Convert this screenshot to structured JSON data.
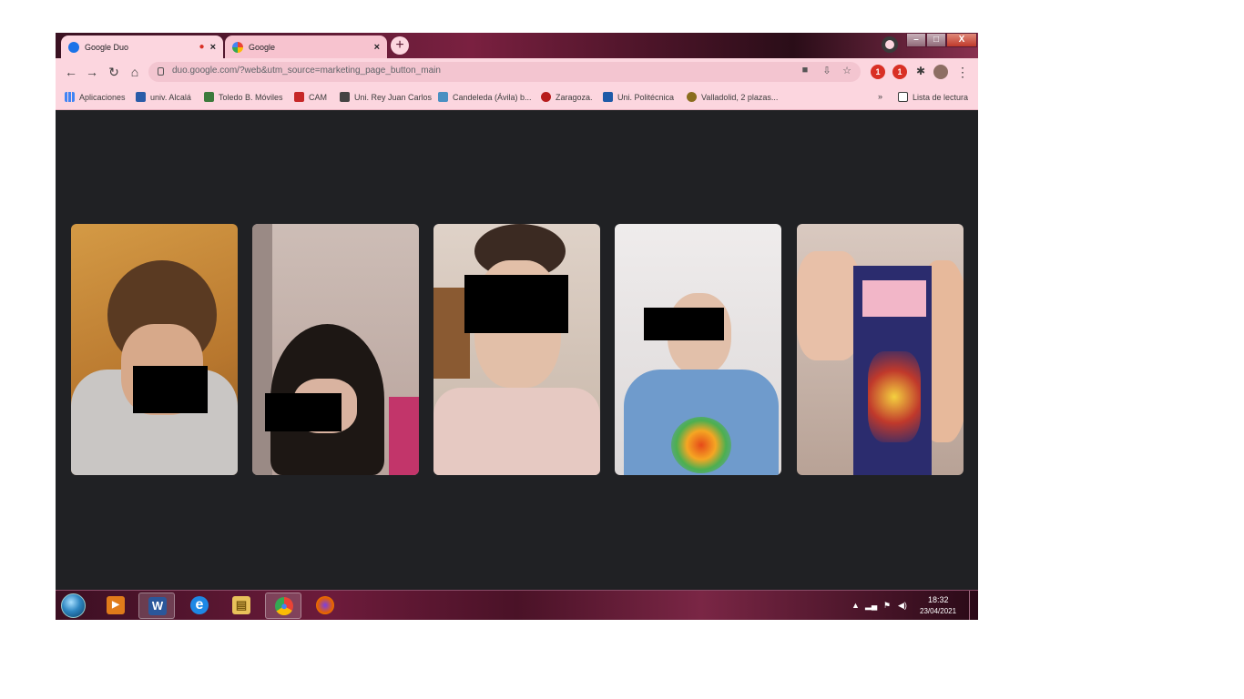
{
  "browser": {
    "tabs": [
      {
        "title": "Google Duo",
        "active": true
      },
      {
        "title": "Google",
        "active": false
      }
    ],
    "new_tab_label": "+",
    "address_bar": {
      "url": "duo.google.com/?web&utm_source=marketing_page_button_main"
    },
    "window_controls": {
      "minimize": "–",
      "maximize": "□",
      "close": "X"
    },
    "extensions": [
      {
        "name": "ext-1",
        "badge": "1",
        "color": "#d93025"
      },
      {
        "name": "ext-2",
        "badge": "1",
        "color": "#d93025"
      }
    ]
  },
  "bookmarks": {
    "items": [
      {
        "label": "Aplicaciones",
        "icon_color": "#4285f4"
      },
      {
        "label": "univ. Alcalá",
        "icon_color": "#2a5ca8"
      },
      {
        "label": "Toledo B. Móviles",
        "icon_color": "#3c7a3c"
      },
      {
        "label": "CAM",
        "icon_color": "#c62828"
      },
      {
        "label": "Uni. Rey Juan Carlos",
        "icon_color": "#444444"
      },
      {
        "label": "Candeleda (Ávila) b...",
        "icon_color": "#4a90c2"
      },
      {
        "label": "Zaragoza.",
        "icon_color": "#b71c1c"
      },
      {
        "label": "Uni. Politécnica",
        "icon_color": "#1e5aa8"
      },
      {
        "label": "Valladolid, 2 plazas...",
        "icon_color": "#8a6d1e"
      }
    ],
    "overflow": "»",
    "reading_list": "Lista de lectura"
  },
  "call": {
    "participants": [
      {
        "tile": 1,
        "background": "#c98a3e"
      },
      {
        "tile": 2,
        "background": "#d6c7c2"
      },
      {
        "tile": 3,
        "background": "#d8c7b9"
      },
      {
        "tile": 4,
        "background": "#e6e3e3"
      },
      {
        "tile": 5,
        "background": "#d9c9c0"
      }
    ]
  },
  "taskbar": {
    "apps": [
      {
        "name": "media-player",
        "color": "#e07b1a",
        "glyph": "▶"
      },
      {
        "name": "word",
        "color": "#2b579a",
        "glyph": "W"
      },
      {
        "name": "internet-explorer",
        "color": "#1e88e5",
        "glyph": "e"
      },
      {
        "name": "file-explorer",
        "color": "#e8c15a",
        "glyph": "▤"
      },
      {
        "name": "chrome",
        "color": "#34a853",
        "glyph": "●"
      },
      {
        "name": "firefox",
        "color": "#e66000",
        "glyph": "●"
      }
    ],
    "clock": {
      "time": "18:32",
      "date": "23/04/2021"
    }
  }
}
